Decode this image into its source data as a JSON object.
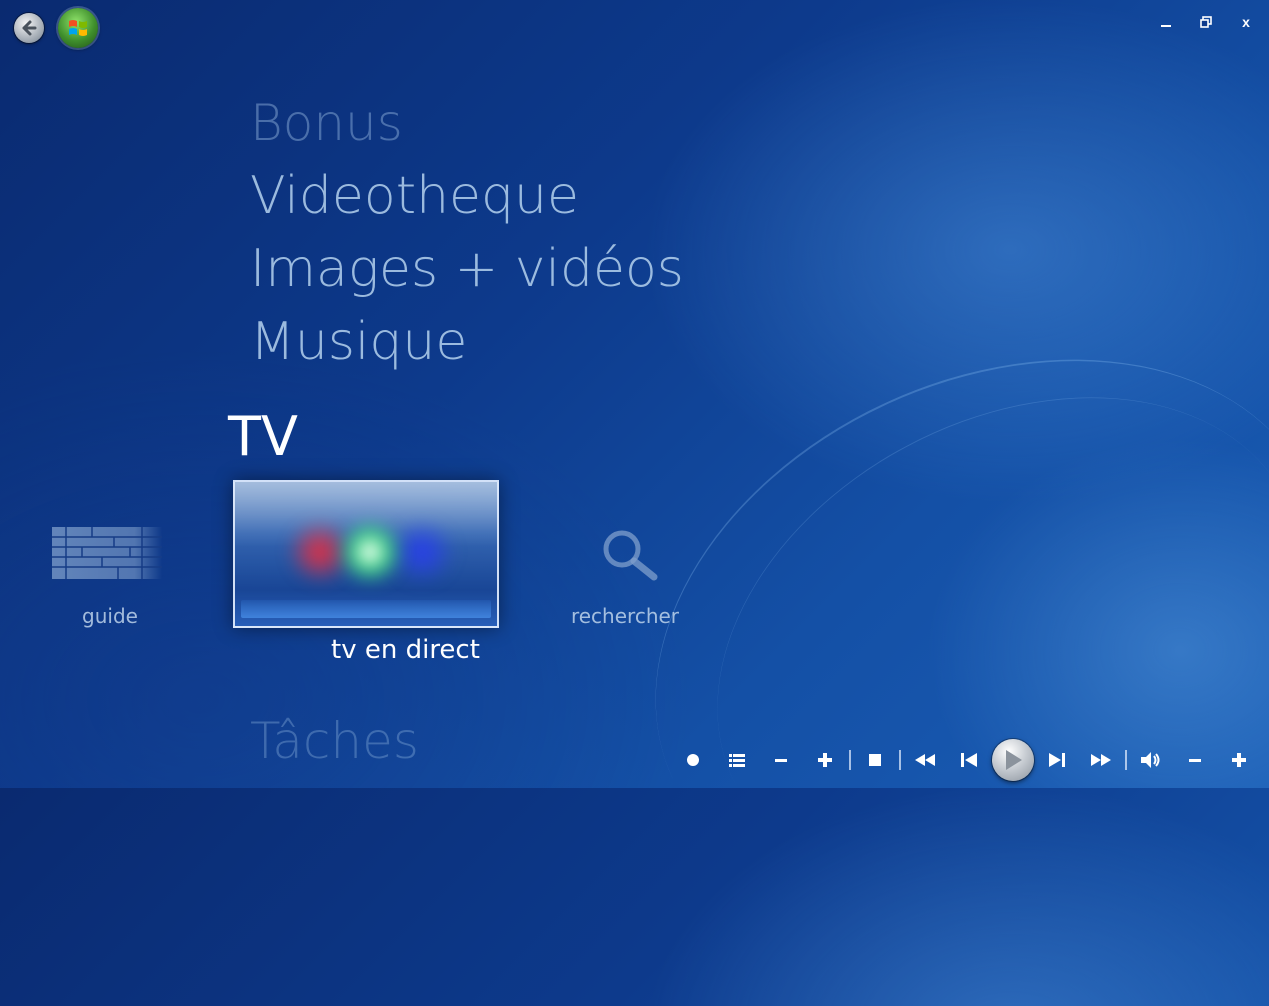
{
  "menu": {
    "items": [
      {
        "label": "Bonus"
      },
      {
        "label": "Videotheque"
      },
      {
        "label": "Images + vidéos"
      },
      {
        "label": "Musique"
      }
    ],
    "current": {
      "label": "TV"
    },
    "next": {
      "label": "Tâches"
    }
  },
  "tv_strip": {
    "guide": {
      "label": "guide",
      "icon": "guide-grid-icon"
    },
    "live": {
      "label": "tv en direct",
      "icon": "live-tv-icon"
    },
    "search": {
      "label": "rechercher",
      "icon": "search-icon"
    }
  },
  "window_controls": {
    "minimize": "minimize-icon",
    "restore": "restore-icon",
    "close": "x"
  },
  "transport": {
    "buttons": [
      "record",
      "guide-list",
      "channel-down",
      "channel-up",
      "stop",
      "rewind",
      "previous",
      "play",
      "next",
      "fast-forward",
      "mute",
      "volume-down",
      "volume-up"
    ]
  },
  "colors": {
    "background": "#0d3a8c",
    "menu_text": "#afcdeb",
    "selected_text": "#ffffff"
  }
}
